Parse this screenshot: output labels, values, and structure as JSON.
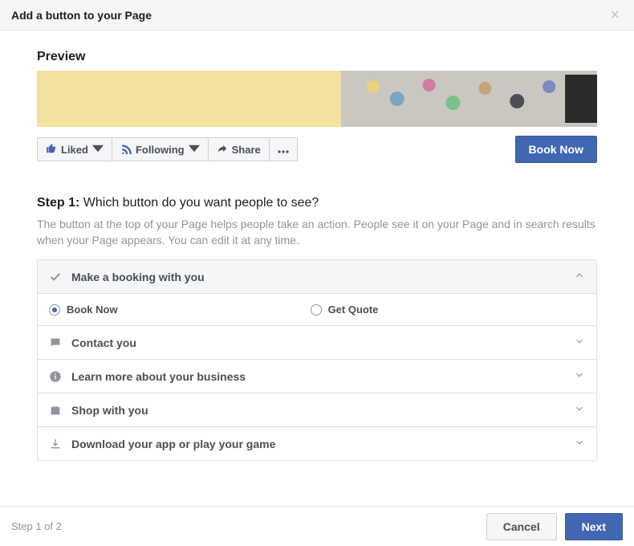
{
  "modal": {
    "title": "Add a button to your Page"
  },
  "preview": {
    "label": "Preview",
    "actions": {
      "liked": "Liked",
      "following": "Following",
      "share": "Share"
    },
    "cta": "Book Now"
  },
  "step": {
    "label": "Step 1:",
    "question": "Which button do you want people to see?",
    "description": "The button at the top of your Page helps people take an action. People see it on your Page and in search results when your Page appears. You can edit it at any time."
  },
  "options": {
    "booking": {
      "label": "Make a booking with you",
      "radio_book": "Book Now",
      "radio_quote": "Get Quote"
    },
    "contact": {
      "label": "Contact you"
    },
    "learn": {
      "label": "Learn more about your business"
    },
    "shop": {
      "label": "Shop with you"
    },
    "download": {
      "label": "Download your app or play your game"
    }
  },
  "footer": {
    "step_count": "Step 1 of 2",
    "cancel": "Cancel",
    "next": "Next"
  }
}
